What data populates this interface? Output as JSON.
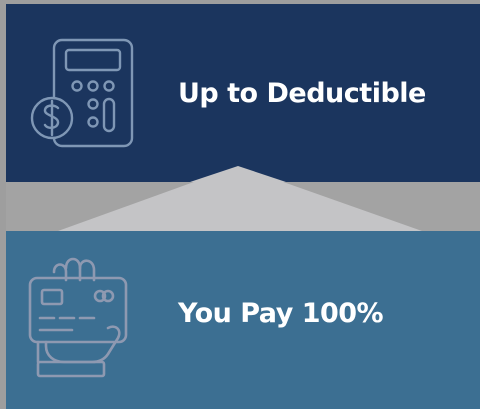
{
  "steps": [
    {
      "label": "Up to Deductible",
      "icon": "calculator-dollar-icon",
      "background": "#1b355e",
      "icon_color": "#7f97b5"
    },
    {
      "label": "You Pay 100%",
      "icon": "credit-card-hand-icon",
      "background": "#3c6f92",
      "icon_color": "#8e99b1"
    }
  ],
  "colors": {
    "frame": "#9e9e9e",
    "connector": "#c4c4c6",
    "text": "#ffffff"
  }
}
